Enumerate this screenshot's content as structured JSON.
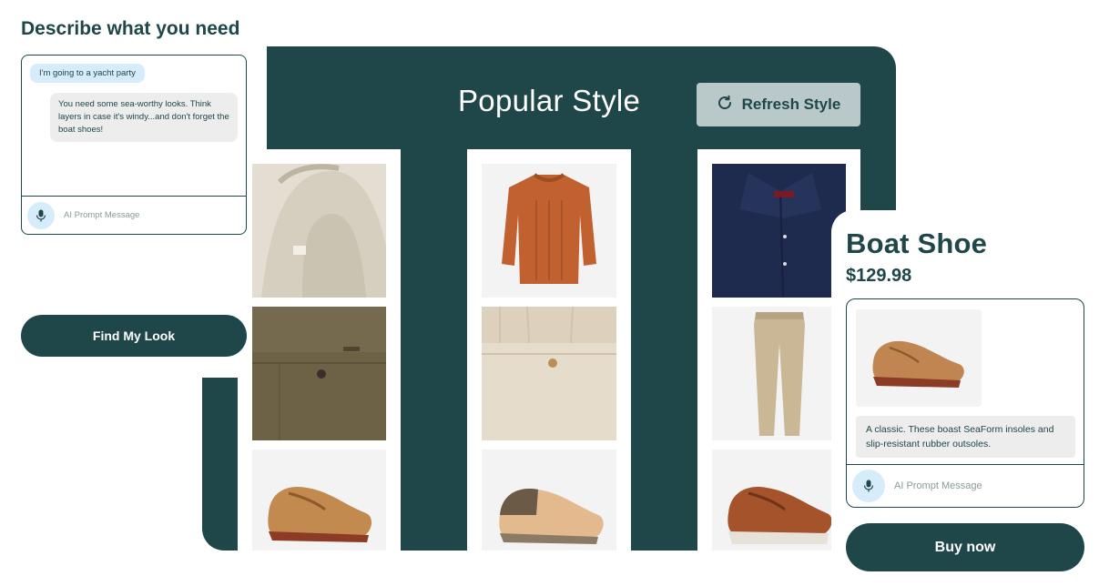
{
  "chat": {
    "title": "Describe what you need",
    "user_message": "I'm going to a yacht party",
    "ai_message": "You need some sea-worthy looks. Think layers in case it's windy...and don't forget the boat shoes!",
    "prompt_placeholder": "AI Prompt Message",
    "find_button": "Find My Look"
  },
  "panel": {
    "title": "Popular Style",
    "refresh_button": "Refresh Style",
    "columns": [
      {
        "items": [
          "hooded-knit-sweater",
          "olive-chino-pants",
          "tan-boat-shoe"
        ]
      },
      {
        "items": [
          "rust-cable-knit-sweater",
          "cream-chino-pants",
          "two-tone-boat-shoe"
        ]
      },
      {
        "items": [
          "navy-dress-shirt",
          "khaki-trousers",
          "brown-lug-sole-boat-shoe"
        ]
      }
    ]
  },
  "product": {
    "name": "Boat Shoe",
    "price": "$129.98",
    "description": "A classic. These boast SeaForm insoles and slip-resistant rubber outsoles.",
    "prompt_placeholder": "AI Prompt Message",
    "buy_button": "Buy now"
  },
  "colors": {
    "brand_dark": "#1f474a",
    "refresh_bg": "#b9c8c8",
    "bubble_user": "#d6ecfb",
    "bubble_ai": "#ededed"
  }
}
